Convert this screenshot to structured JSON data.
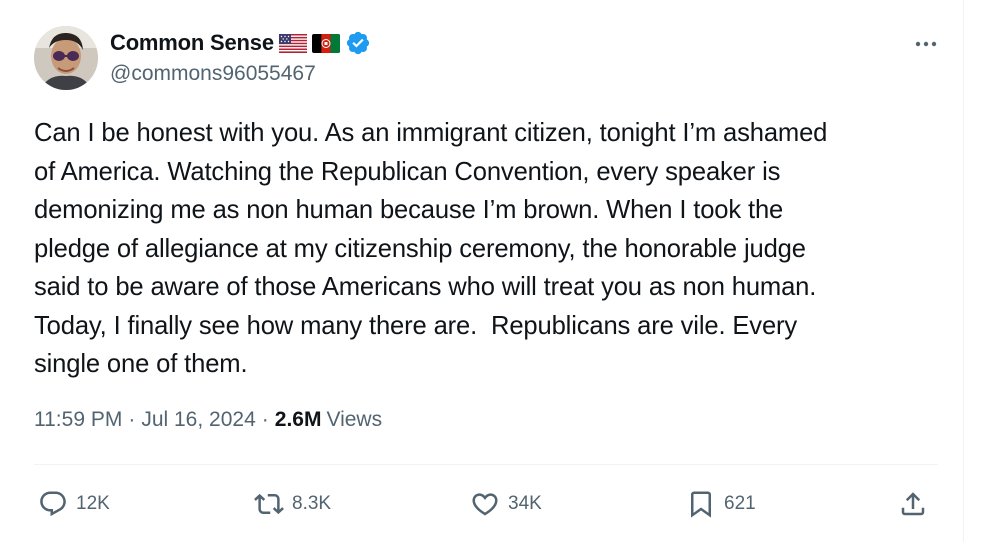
{
  "author": {
    "display_name": "Common Sense",
    "handle": "@commons96055467",
    "verified": true,
    "flags": [
      "us-flag-icon",
      "afghanistan-flag-icon"
    ]
  },
  "tweet": {
    "text": "Can I be honest with you. As an immigrant citizen, tonight I’m ashamed\nof America. Watching the Republican Convention, every speaker is\ndemonizing me as non human because I’m brown. When I took the\npledge of allegiance at my citizenship ceremony, the honorable judge\nsaid to be aware of those Americans who will treat you as non human.\nToday, I finally see how many there are.  Republicans are vile. Every\nsingle one of them."
  },
  "meta": {
    "time": "11:59 PM",
    "separator": "·",
    "date": "Jul 16, 2024",
    "views_count": "2.6M",
    "views_label": "Views"
  },
  "actions": {
    "replies": "12K",
    "retweets": "8.3K",
    "likes": "34K",
    "bookmarks": "621"
  },
  "colors": {
    "text": "#0f1419",
    "secondary": "#536471",
    "verified": "#1d9bf0",
    "divider": "#eff3f4"
  }
}
